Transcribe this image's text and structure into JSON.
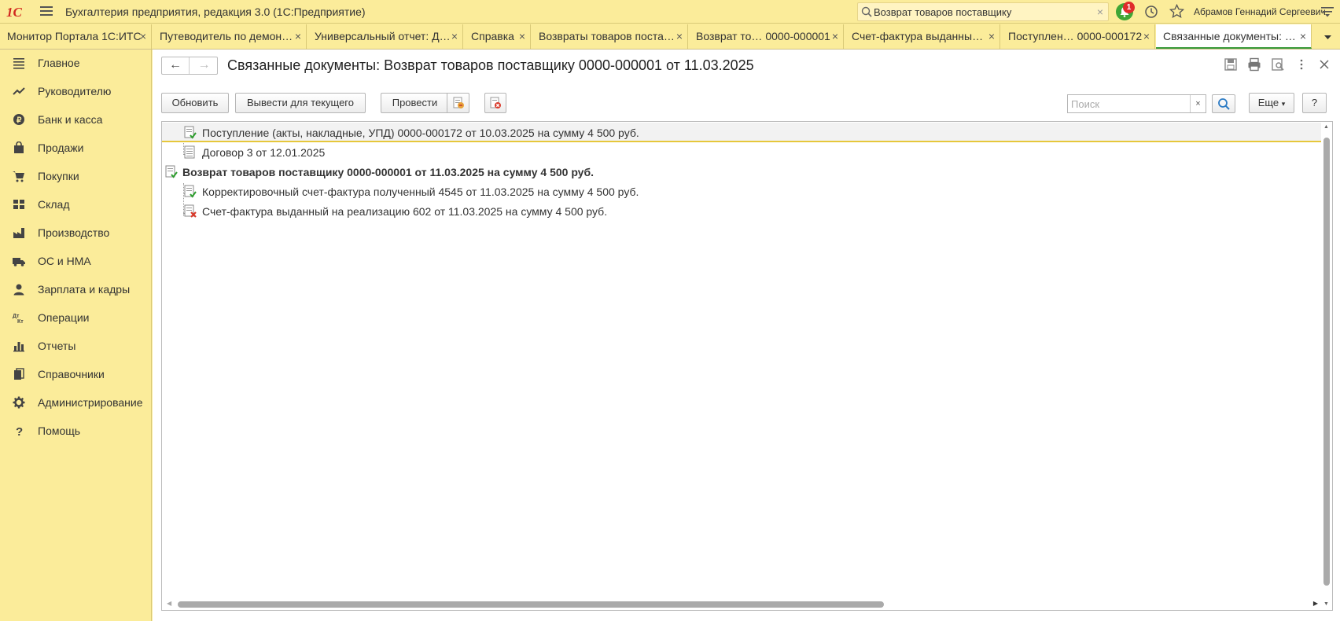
{
  "app": {
    "logo": "1С",
    "title": "Бухгалтерия предприятия, редакция 3.0  (1С:Предприятие)",
    "search_value": "Возврат товаров поставщику",
    "notifications_count": "1",
    "user": "Абрамов Геннадий Сергеевич"
  },
  "tabs": [
    {
      "label": "Монитор Портала 1С:ИТС"
    },
    {
      "label": "Путеводитель по демон…"
    },
    {
      "label": "Универсальный отчет: Д…"
    },
    {
      "label": "Справка"
    },
    {
      "label": "Возвраты товаров поста…"
    },
    {
      "label": "Возврат то…  0000-000001"
    },
    {
      "label": "Счет-фактура выданны…"
    },
    {
      "label": "Поступлен…  0000-000172"
    },
    {
      "label": "Связанные документы: …"
    }
  ],
  "sidebar": {
    "items": [
      {
        "label": "Главное",
        "icon": "menu-lines-icon"
      },
      {
        "label": "Руководителю",
        "icon": "trend-icon"
      },
      {
        "label": "Банк и касса",
        "icon": "coin-icon"
      },
      {
        "label": "Продажи",
        "icon": "bag-icon"
      },
      {
        "label": "Покупки",
        "icon": "cart-icon"
      },
      {
        "label": "Склад",
        "icon": "warehouse-icon"
      },
      {
        "label": "Производство",
        "icon": "factory-icon"
      },
      {
        "label": "ОС и НМА",
        "icon": "truck-icon"
      },
      {
        "label": "Зарплата и кадры",
        "icon": "person-icon"
      },
      {
        "label": "Операции",
        "icon": "operations-icon"
      },
      {
        "label": "Отчеты",
        "icon": "bar-chart-icon"
      },
      {
        "label": "Справочники",
        "icon": "books-icon"
      },
      {
        "label": "Администрирование",
        "icon": "gear-icon"
      },
      {
        "label": "Помощь",
        "icon": "question-icon"
      }
    ]
  },
  "form": {
    "title": "Связанные документы: Возврат товаров поставщику 0000-000001 от 11.03.2025",
    "toolbar": {
      "refresh": "Обновить",
      "show_current": "Вывести для текущего",
      "post": "Провести",
      "search_placeholder": "Поиск",
      "search_clear": "×",
      "more": "Еще",
      "help": "?"
    },
    "tree": [
      {
        "text": "Поступление (акты, накладные, УПД) 0000-000172 от 10.03.2025 на сумму 4 500 руб.",
        "bold": false,
        "status": "posted"
      },
      {
        "text": "Договор 3 от 12.01.2025",
        "bold": false,
        "status": "plain"
      },
      {
        "text": "Возврат товаров поставщику 0000-000001 от 11.03.2025 на сумму 4 500 руб.",
        "bold": true,
        "status": "posted"
      },
      {
        "text": "Корректировочный счет-фактура полученный 4545 от 11.03.2025 на сумму 4 500 руб.",
        "bold": false,
        "status": "posted"
      },
      {
        "text": "Счет-фактура выданный на реализацию 602 от 11.03.2025 на сумму 4 500 руб.",
        "bold": false,
        "status": "deleted"
      }
    ]
  }
}
